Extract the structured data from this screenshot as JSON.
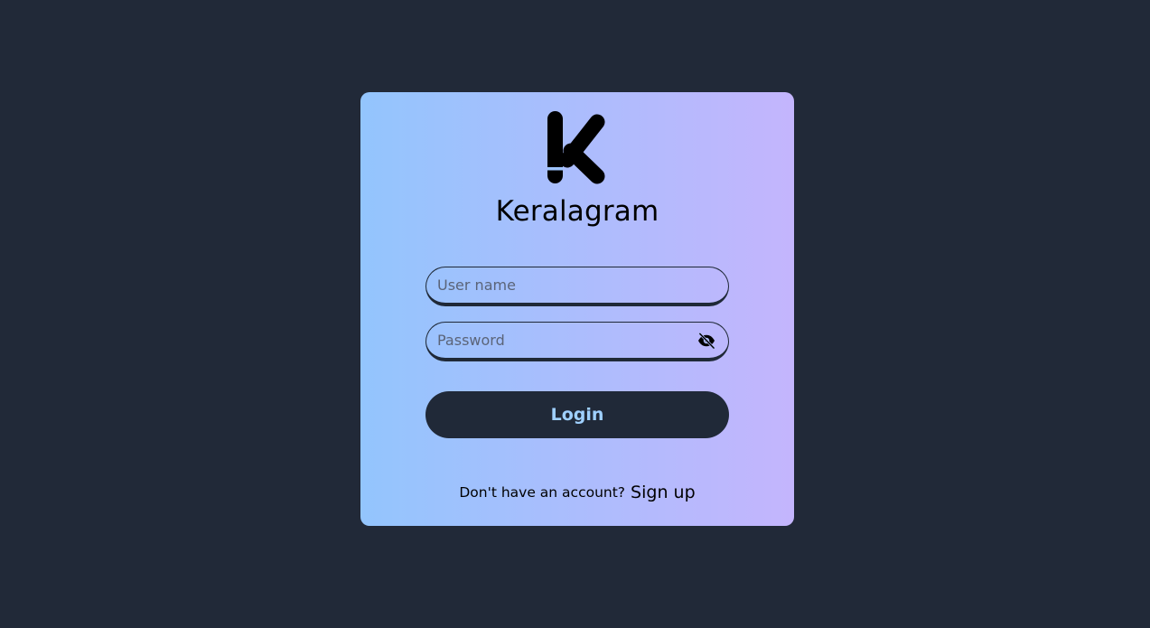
{
  "brand": {
    "name": "Keralagram",
    "logo_icon": "k-logo-icon"
  },
  "form": {
    "username_placeholder": "User name",
    "username_value": "",
    "password_placeholder": "Password",
    "password_value": "",
    "toggle_icon": "eye-slash-icon",
    "login_label": "Login"
  },
  "signup": {
    "prompt": "Don't have an account?",
    "link_label": "Sign up"
  },
  "colors": {
    "background": "#212938",
    "card_gradient_start": "#93c5fd",
    "card_gradient_end": "#c4b5fd",
    "button_bg": "#202938",
    "button_text": "#9fd0ff"
  }
}
